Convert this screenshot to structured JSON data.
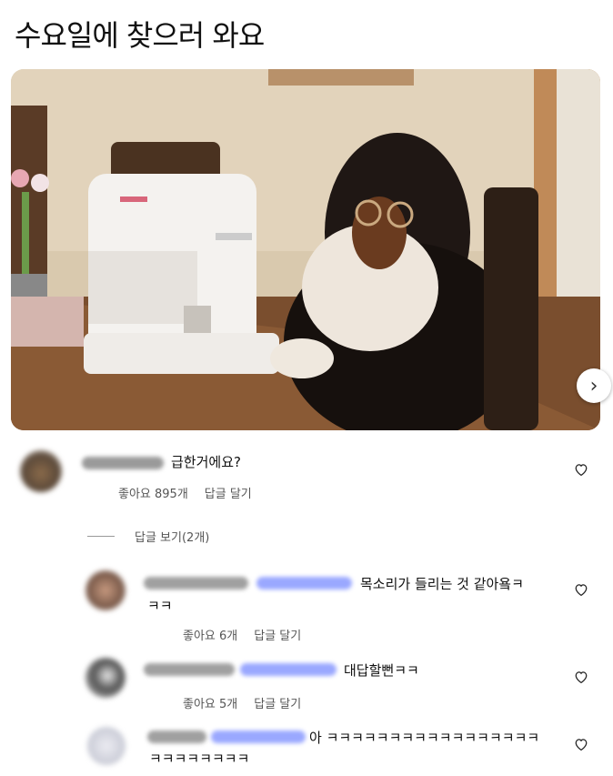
{
  "post": {
    "title": "수요일에 찾으러 와요"
  },
  "comments": [
    {
      "text": "급한거에요?",
      "likes": "좋아요 895개",
      "reply": "답글 달기"
    }
  ],
  "view_replies": "답글 보기(2개)",
  "replies": [
    {
      "text_line1": "목소리가 들리는 것 같아욬ㅋ",
      "text_line2": "ㅋㅋ",
      "likes": "좋아요 6개",
      "reply": "답글 달기"
    },
    {
      "text_line1": "대답할뻔ㅋㅋ",
      "likes": "좋아요 5개",
      "reply": "답글 달기"
    },
    {
      "text_line1": "아 ㅋㅋㅋㅋㅋㅋㅋㅋㅋㅋㅋㅋㅋㅋㅋㅋㅋ",
      "text_line2": "ㅋㅋㅋㅋㅋㅋㅋㅋ"
    }
  ],
  "icons": {
    "heart": "heart-icon",
    "next": "chevron-right-icon"
  },
  "colors": {
    "mention": "#9aa8ff"
  }
}
